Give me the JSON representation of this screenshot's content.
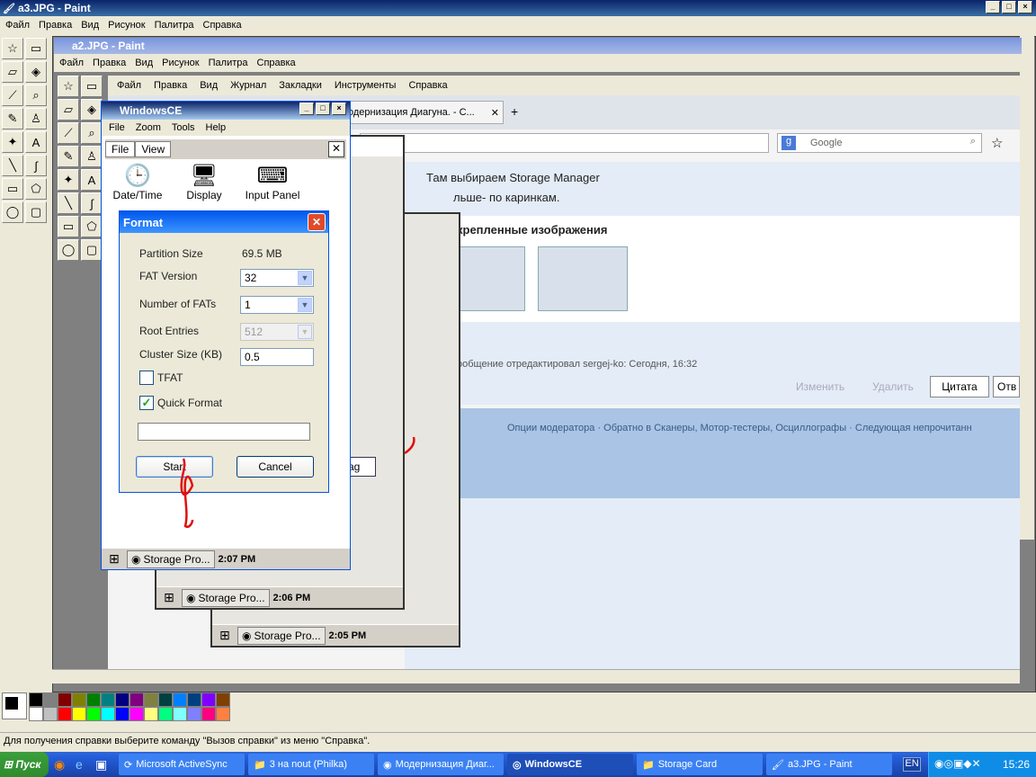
{
  "outer": {
    "title": "a3.JPG - Paint",
    "menu": [
      "Файл",
      "Правка",
      "Вид",
      "Рисунок",
      "Палитра",
      "Справка"
    ],
    "status": "Для получения справки выберите команду \"Вызов справки\" из меню \"Справка\"."
  },
  "inner": {
    "title": "a2.JPG - Paint",
    "menu": [
      "Файл",
      "Правка",
      "Вид",
      "Рисунок",
      "Палитра",
      "Справка"
    ]
  },
  "browser": {
    "menu": [
      "Файл",
      "Правка",
      "Вид",
      "Журнал",
      "Закладки",
      "Инструменты",
      "Справка"
    ],
    "tab_title": "одернизация Диагуна. - С...",
    "search_placeholder": "Google",
    "post_line1": "Там выбираем Storage Manager",
    "post_line2": "льше- по каринкам.",
    "attached_heading": "крепленные изображения",
    "edited_text": "ообщение отредактировал sergej-ko: Сегодня, 16:32",
    "btn_edit": "Изменить",
    "btn_delete": "Удалить",
    "btn_quote": "Цитата",
    "btn_reply": "Отв",
    "footer_links": "Опции модератора · Обратно в Сканеры, Мотор-тестеры, Осциллографы · Следующая непрочитанн"
  },
  "ce": {
    "title": "WindowsCE",
    "menu": [
      "File",
      "Zoom",
      "Tools",
      "Help"
    ],
    "cp_menu": [
      "File",
      "View"
    ],
    "icons": [
      "Date/Time",
      "Display",
      "Input Panel"
    ],
    "task_label": "Storage Pro...",
    "clocks": [
      "2:07 PM",
      "2:06 PM",
      "2:05 PM"
    ],
    "bg_btn": "ag"
  },
  "format": {
    "title": "Format",
    "partition_label": "Partition Size",
    "partition_value": "69.5 MB",
    "fat_label": "FAT Version",
    "fat_value": "32",
    "nfats_label": "Number of FATs",
    "nfats_value": "1",
    "root_label": "Root Entries",
    "root_value": "512",
    "cluster_label": "Cluster Size (KB)",
    "cluster_value": "0.5",
    "tfat_label": "TFAT",
    "quick_label": "Quick Format",
    "start_label": "Start",
    "cancel_label": "Cancel"
  },
  "taskbar": {
    "start": "Пуск",
    "items": [
      "Microsoft ActiveSync",
      "3 на nout (Philka)",
      "Модернизация Диаг...",
      "WindowsCE",
      "Storage Card",
      "a3.JPG - Paint"
    ],
    "lang": "EN",
    "time": "15:26"
  },
  "colors": {
    "accent": "#0a246a",
    "xp_blue": "#245edb",
    "ce_title": "#0054e3"
  }
}
